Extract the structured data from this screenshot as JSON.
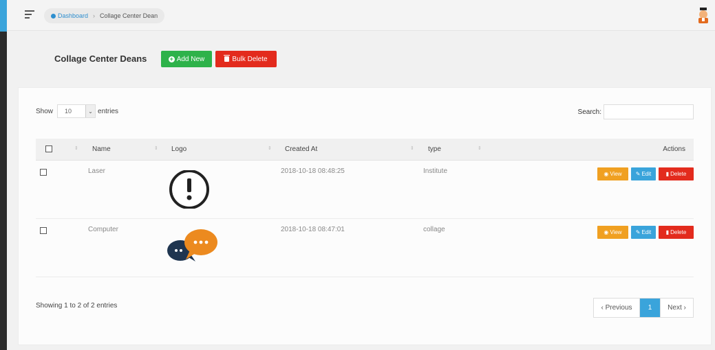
{
  "breadcrumb": {
    "home": "Dashboard",
    "current": "Collage Center Dean"
  },
  "page": {
    "title": "Collage Center Deans",
    "add_label": "Add New",
    "bulk_label": "Bulk Delete"
  },
  "controls": {
    "show_label": "Show",
    "page_size": "10",
    "entries_label": "entries",
    "search_label": "Search:"
  },
  "table": {
    "columns": [
      "Name",
      "Logo",
      "Created At",
      "type",
      "Actions"
    ],
    "rows": [
      {
        "name": "Laser",
        "created_at": "2018-10-18 08:48:25",
        "type": "Institute",
        "logo": "exclamation-circle-icon"
      },
      {
        "name": "Computer",
        "created_at": "2018-10-18 08:47:01",
        "type": "collage",
        "logo": "chat-bubbles-icon"
      }
    ],
    "actions": {
      "view": "View",
      "edit": "Edit",
      "delete": "Delete"
    }
  },
  "footer": {
    "info": "Showing 1 to 2 of 2 entries",
    "prev": "‹ Previous",
    "page": "1",
    "next": "Next ›"
  },
  "colors": {
    "add": "#2eb24a",
    "delete": "#e32b1d",
    "view": "#f0a021",
    "edit": "#3aa4db"
  }
}
